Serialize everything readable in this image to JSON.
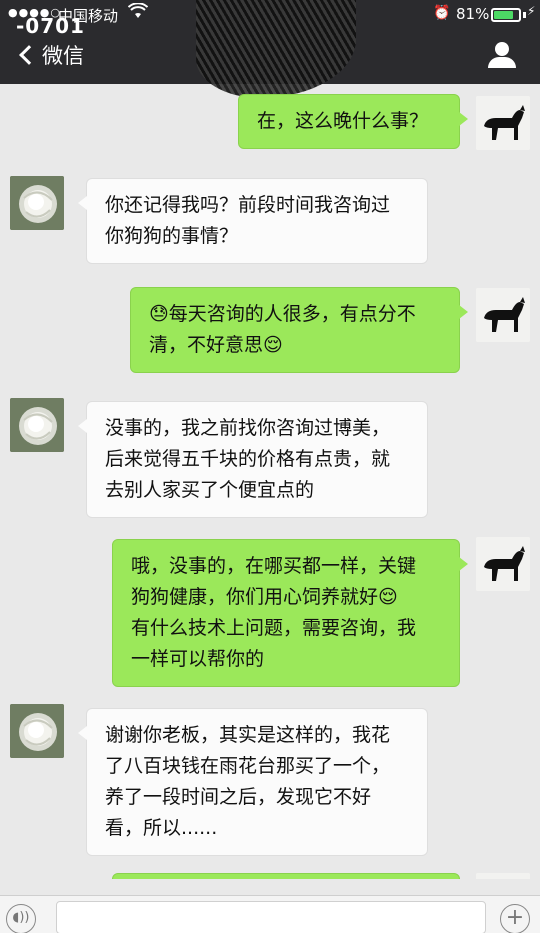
{
  "status_bar": {
    "signal": "●●●●○",
    "carrier": "中国移动",
    "clock_overlay": "-0701",
    "battery_percent": "81%",
    "battery_level": 0.81
  },
  "nav": {
    "back_label": "微信"
  },
  "messages": [
    {
      "side": "me",
      "lines": [
        "在，这么晚什么事？"
      ]
    },
    {
      "side": "them",
      "lines": [
        "你还记得我吗？前段时间我咨询过",
        "你狗狗的事情？"
      ]
    },
    {
      "side": "me",
      "lines": [
        "😓每天咨询的人很多，有点分不",
        "清，不好意思😌"
      ]
    },
    {
      "side": "them",
      "lines": [
        "没事的，我之前找你咨询过博美，",
        "后来觉得五千块的价格有点贵，就",
        "去别人家买了个便宜点的"
      ]
    },
    {
      "side": "me",
      "lines": [
        "哦，没事的，在哪买都一样，关键",
        "狗狗健康，你们用心饲养就好😌",
        "有什么技术上问题，需要咨询，我",
        "一样可以帮你的"
      ]
    },
    {
      "side": "them",
      "lines": [
        "谢谢你老板，其实是这样的，我花",
        "了八百块钱在雨花台那买了一个，",
        "养了一段时间之后，发现它不好",
        "看，所以......"
      ]
    },
    {
      "side": "me",
      "lines": [
        ""
      ]
    }
  ],
  "colors": {
    "header_bg": "#2b2b2e",
    "chat_bg": "#e9e9e9",
    "my_bubble": "#9be85a",
    "their_bubble": "#fbfbfb"
  },
  "icons": {
    "back": "chevron-left-icon",
    "profile": "person-icon",
    "voice": "voice-icon",
    "plus": "plus-icon",
    "wifi": "wifi-icon",
    "alarm": "alarm-icon"
  }
}
